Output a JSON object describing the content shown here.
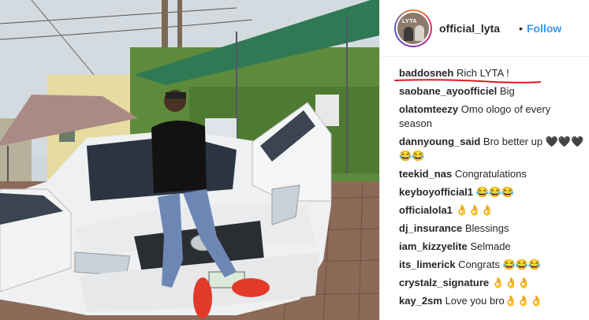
{
  "post": {
    "username": "official_lyta",
    "separator": "•",
    "follow_label": "Follow",
    "avatar_tag": "LYTA",
    "accent_color": "#3897f0"
  },
  "comments": [
    {
      "user": "baddosneh",
      "text": "Rich LYTA !"
    },
    {
      "user": "saobane_ayoofficiel",
      "text": "Big"
    },
    {
      "user": "olatomteezy",
      "text": "Omo ologo of every season"
    },
    {
      "user": "dannyoung_said",
      "text": "Bro better up 🖤🖤🖤 😂😂"
    },
    {
      "user": "teekid_nas",
      "text": "Congratulations"
    },
    {
      "user": "keyboyofficial1",
      "text": "😂😂😂"
    },
    {
      "user": "officialola1",
      "text": "👌👌👌"
    },
    {
      "user": "dj_insurance",
      "text": "Blessings"
    },
    {
      "user": "iam_kizzyelite",
      "text": "Selmade"
    },
    {
      "user": "its_limerick",
      "text": "Congrats 😂😂😂"
    },
    {
      "user": "crystalz_signature",
      "text": "👌👌👌"
    },
    {
      "user": "kay_2sm",
      "text": "Love you bro👌👌👌"
    }
  ],
  "annotation_color": "#e0191f"
}
